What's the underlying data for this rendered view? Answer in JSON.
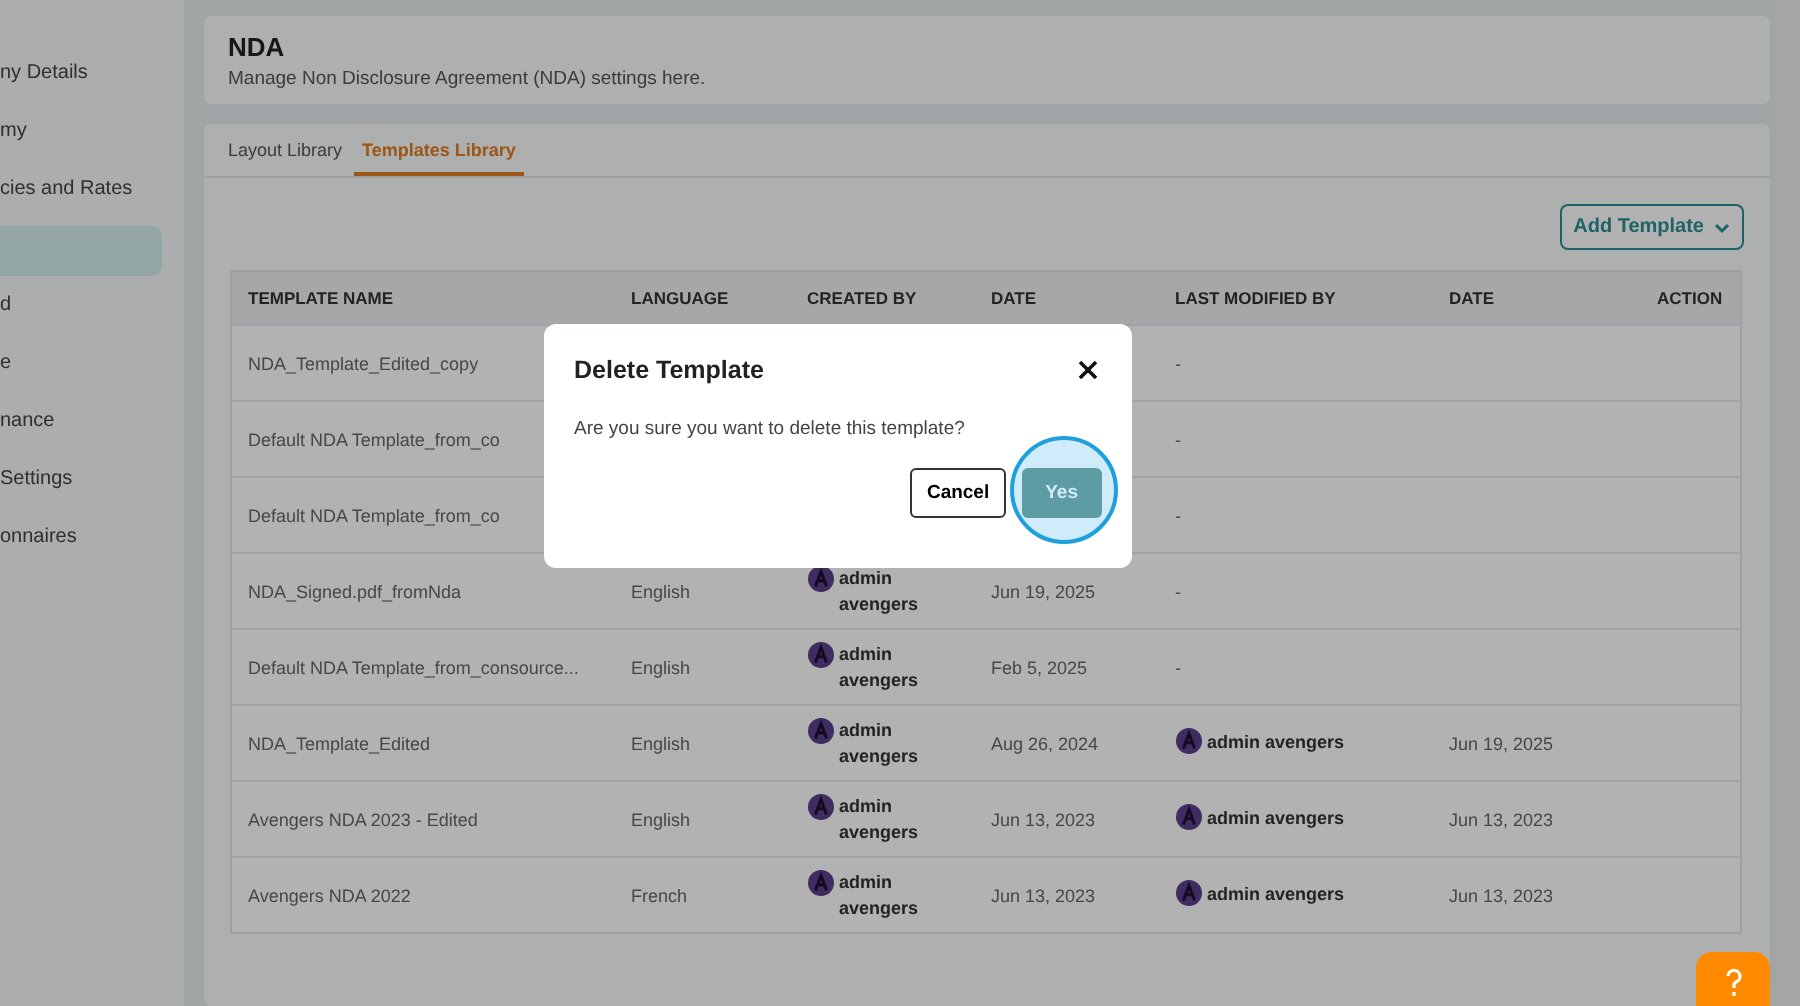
{
  "sidebar": {
    "items": [
      {
        "label": "ny Details",
        "selected": false
      },
      {
        "label": "my",
        "selected": false
      },
      {
        "label": "cies and Rates",
        "selected": false
      },
      {
        "selected": true
      },
      {
        "label": "d",
        "selected": false
      },
      {
        "label": "e",
        "selected": false
      },
      {
        "label": "nance",
        "selected": false
      },
      {
        "label": "Settings",
        "selected": false
      },
      {
        "label": "onnaires",
        "selected": false
      }
    ]
  },
  "header": {
    "title": "NDA",
    "subtitle": "Manage Non Disclosure Agreement (NDA) settings here."
  },
  "tabs": [
    {
      "label": "Layout Library",
      "selected": false
    },
    {
      "label": "Templates Library",
      "selected": true
    }
  ],
  "add_button": {
    "label": "Add Template"
  },
  "table": {
    "columns": [
      "TEMPLATE NAME",
      "LANGUAGE",
      "CREATED BY",
      "DATE",
      "LAST MODIFIED BY",
      "DATE",
      "ACTION"
    ],
    "rows": [
      {
        "name": "NDA_Template_Edited_copy",
        "modified_by": "-"
      },
      {
        "name": "Default NDA Template_from_co",
        "modified_by": "-"
      },
      {
        "name": "Default NDA Template_from_co",
        "modified_by": "-"
      },
      {
        "name": "NDA_Signed.pdf_fromNda",
        "language": "English",
        "created_by": "admin avengers",
        "date": "Jun 19, 2025",
        "modified_by": "-"
      },
      {
        "name": "Default NDA Template_from_consource...",
        "language": "English",
        "created_by": "admin avengers",
        "date": "Feb 5, 2025",
        "modified_by": "-"
      },
      {
        "name": "NDA_Template_Edited",
        "language": "English",
        "created_by": "admin avengers",
        "date": "Aug 26, 2024",
        "modified_by": "admin avengers",
        "modified_date": "Jun 19, 2025"
      },
      {
        "name": "Avengers NDA 2023 - Edited",
        "language": "English",
        "created_by": "admin avengers",
        "date": "Jun 13, 2023",
        "modified_by": "admin avengers",
        "modified_date": "Jun 13, 2023"
      },
      {
        "name": "Avengers NDA 2022",
        "language": "French",
        "created_by": "admin avengers",
        "date": "Jun 13, 2023",
        "modified_by": "admin avengers",
        "modified_date": "Jun 13, 2023"
      }
    ]
  },
  "dialog": {
    "title": "Delete Template",
    "message": "Are you sure you want to delete this template?",
    "cancel": "Cancel",
    "confirm": "Yes"
  }
}
